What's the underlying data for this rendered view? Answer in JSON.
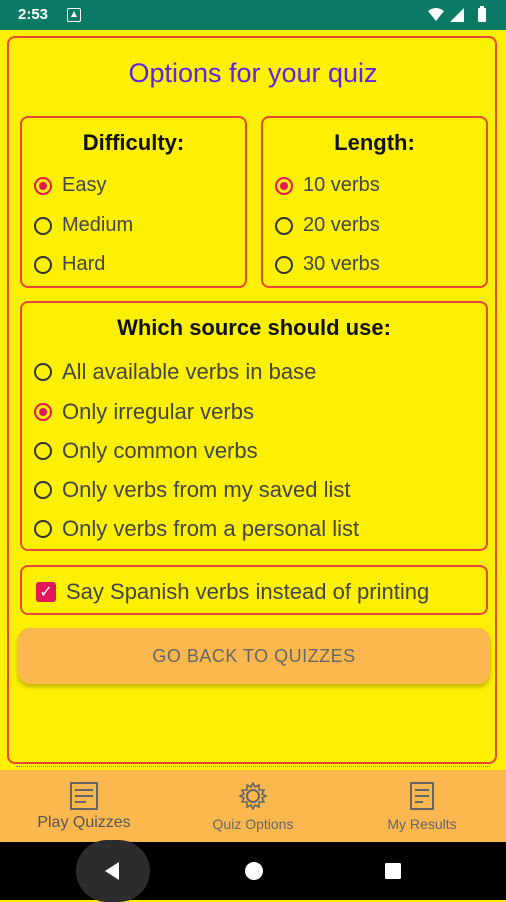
{
  "status": {
    "time": "2:53"
  },
  "title": "Options for your quiz",
  "difficulty": {
    "title": "Difficulty:",
    "options": [
      {
        "label": "Easy",
        "checked": true
      },
      {
        "label": "Medium",
        "checked": false
      },
      {
        "label": "Hard",
        "checked": false
      }
    ]
  },
  "length": {
    "title": "Length:",
    "options": [
      {
        "label": "10 verbs",
        "checked": true
      },
      {
        "label": "20 verbs",
        "checked": false
      },
      {
        "label": "30 verbs",
        "checked": false
      }
    ]
  },
  "source": {
    "title": "Which source should use:",
    "options": [
      {
        "label": "All available verbs in base",
        "checked": false
      },
      {
        "label": "Only irregular verbs",
        "checked": true
      },
      {
        "label": "Only common verbs",
        "checked": false
      },
      {
        "label": "Only verbs from my saved list",
        "checked": false
      },
      {
        "label": "Only verbs from a personal list",
        "checked": false
      }
    ]
  },
  "say_option": {
    "label": "Say Spanish verbs instead of printing",
    "checked": true
  },
  "back_button": "GO BACK TO QUIZZES",
  "nav": {
    "items": [
      {
        "label": "Play Quizzes",
        "icon": "quiz-icon",
        "active": true
      },
      {
        "label": "Quiz Options",
        "icon": "gear-icon",
        "active": false
      },
      {
        "label": "My Results",
        "icon": "results-icon",
        "active": false
      }
    ]
  },
  "colors": {
    "background": "#fdf000",
    "border": "#e8473a",
    "title": "#5f23e6",
    "accent": "#e2185b",
    "status_bar": "#0b7a65",
    "bottom_nav": "#fbb84e"
  }
}
